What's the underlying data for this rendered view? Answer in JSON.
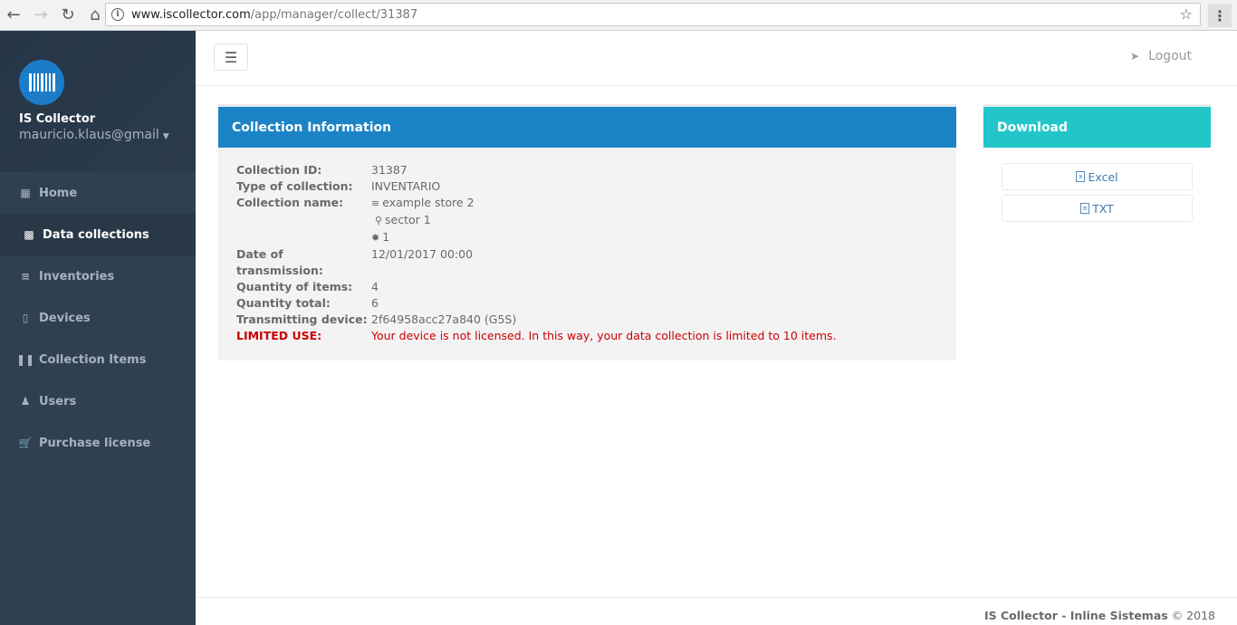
{
  "browser": {
    "url_host": "www.iscollector.com",
    "url_path": "/app/manager/collect/31387"
  },
  "sidebar": {
    "app_name": "IS Collector",
    "user_email": "mauricio.klaus@gmail",
    "items": [
      {
        "label": "Home",
        "icon": "th-large-icon",
        "active": false
      },
      {
        "label": "Data collections",
        "icon": "folder-icon",
        "active": true
      },
      {
        "label": "Inventories",
        "icon": "list-icon",
        "active": false
      },
      {
        "label": "Devices",
        "icon": "mobile-icon",
        "active": false
      },
      {
        "label": "Collection Items",
        "icon": "barcode-icon",
        "active": false
      },
      {
        "label": "Users",
        "icon": "user-icon",
        "active": false
      },
      {
        "label": "Purchase license",
        "icon": "shopping-cart-icon",
        "active": false
      }
    ]
  },
  "topbar": {
    "logout_label": "Logout"
  },
  "collection": {
    "title": "Collection Information",
    "fields": {
      "id_label": "Collection ID:",
      "id_value": "31387",
      "type_label": "Type of collection:",
      "type_value": "INVENTARIO",
      "name_label": "Collection name:",
      "name_value": "example store 2",
      "sector_value": "sector 1",
      "count_value": "1",
      "date_label": "Date of transmission:",
      "date_value": "12/01/2017 00:00",
      "qty_items_label": "Quantity of items:",
      "qty_items_value": "4",
      "qty_total_label": "Quantity total:",
      "qty_total_value": "6",
      "device_label": "Transmitting device:",
      "device_value": "2f64958acc27a840 (G5S)",
      "limited_label": "LIMITED USE:",
      "limited_value": "Your device is not licensed. In this way, your data collection is limited to 10 items."
    }
  },
  "download": {
    "title": "Download",
    "excel_label": "Excel",
    "txt_label": "TXT"
  },
  "footer": {
    "brand": "IS Collector - Inline Sistemas",
    "copyright": "© 2018"
  },
  "colors": {
    "sidebar_bg": "#2f4050",
    "primary_blue": "#1c84c6",
    "info_teal": "#23c6c8",
    "warning_red": "#cc0000"
  }
}
